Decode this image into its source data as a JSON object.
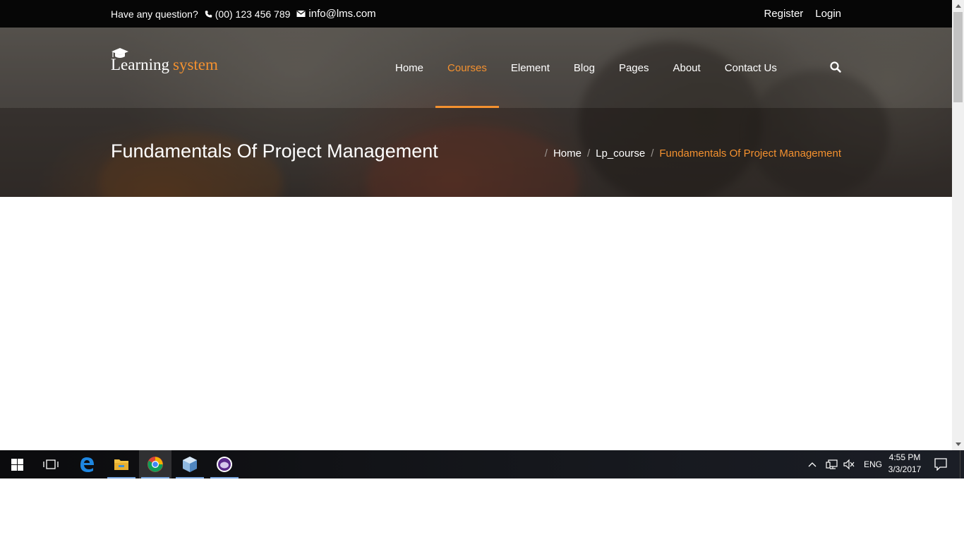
{
  "topbar": {
    "question": "Have any question?",
    "phone": "(00) 123 456 789",
    "email": "info@lms.com",
    "register": "Register",
    "login": "Login"
  },
  "logo": {
    "word1": "Learning",
    "word2": "system"
  },
  "nav": {
    "items": [
      {
        "label": "Home"
      },
      {
        "label": "Courses",
        "active": true
      },
      {
        "label": "Element"
      },
      {
        "label": "Blog"
      },
      {
        "label": "Pages"
      },
      {
        "label": "About"
      },
      {
        "label": "Contact Us"
      }
    ]
  },
  "page": {
    "title": "Fundamentals Of Project Management",
    "breadcrumb": [
      "Home",
      "Lp_course",
      "Fundamentals Of Project Management"
    ]
  },
  "taskbar": {
    "apps": [
      "start-icon",
      "task-view-icon",
      "edge-icon",
      "file-explorer-icon",
      "chrome-icon",
      "virtualbox-icon",
      "app-icon"
    ],
    "language": "ENG",
    "time": "4:55 PM",
    "date": "3/3/2017"
  },
  "colors": {
    "accent": "#f4912f",
    "topbar": "#060606"
  }
}
